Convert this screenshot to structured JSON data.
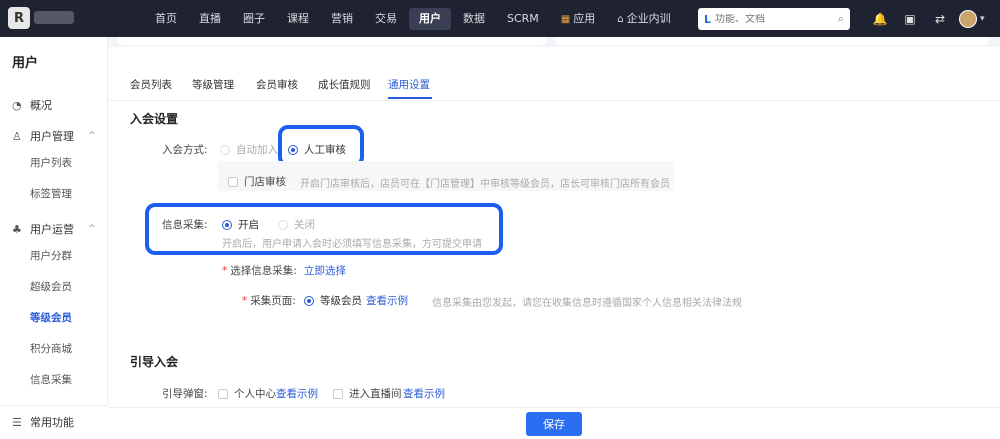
{
  "topbar": {
    "logo_char": "R",
    "nav": [
      {
        "label": "首页",
        "icon": ""
      },
      {
        "label": "直播",
        "icon": ""
      },
      {
        "label": "圈子",
        "icon": ""
      },
      {
        "label": "课程",
        "icon": ""
      },
      {
        "label": "营销",
        "icon": ""
      },
      {
        "label": "交易",
        "icon": ""
      },
      {
        "label": "用户",
        "icon": "",
        "active": true
      },
      {
        "label": "数据",
        "icon": ""
      },
      {
        "label": "SCRM",
        "icon": ""
      },
      {
        "label": "应用",
        "icon": "▦"
      },
      {
        "label": "企业内训",
        "icon": "⌂"
      }
    ],
    "search": {
      "placeholder": "功能、文档",
      "logo_glyph": "L"
    },
    "tools": [
      "🔔",
      "▣",
      "⇄"
    ]
  },
  "sidebar": {
    "title": "用户",
    "groups": [
      {
        "label": "概况",
        "icon": "◔"
      },
      {
        "label": "用户管理",
        "icon": "♙",
        "expand": "^"
      },
      {
        "label": "用户运营",
        "icon": "♣",
        "expand": "^"
      },
      {
        "label": "常用功能",
        "icon": "☰"
      }
    ],
    "sub_mgmt": [
      "用户列表",
      "标签管理"
    ],
    "sub_ops": [
      "用户分群",
      "超级会员",
      "等级会员",
      "积分商城",
      "信息采集"
    ]
  },
  "tabs": [
    "会员列表",
    "等级管理",
    "会员审核",
    "成长值规则",
    "通用设置"
  ],
  "join_settings": {
    "title": "入会设置",
    "mode_label": "入会方式:",
    "options": [
      "自动加入",
      "人工审核"
    ],
    "store_review_label": "门店审核",
    "store_review_hint": "开启门店审核后，店员可在【门店管理】中审核等级会员，店长可审核门店所有会员",
    "info_label": "信息采集:",
    "info_options": [
      "开启",
      "关闭"
    ],
    "info_hint": "开启后，用户申请入会时必须填写信息采集，方可提交申请",
    "select_label": "选择信息采集:",
    "select_link": "立即选择",
    "page_label": "采集页面:",
    "page_option": "等级会员",
    "page_link": "查看示例",
    "page_hint": "信息采集由您发起，请您在收集信息时遵循国家个人信息相关法律法规"
  },
  "guide": {
    "title": "引导入会",
    "popup_label": "引导弹窗:",
    "options": [
      {
        "label": "个人中心",
        "link": "查看示例"
      },
      {
        "label": "进入直播间",
        "link": "查看示例"
      }
    ]
  },
  "footer": {
    "save_label": "保存"
  },
  "colors": {
    "accent": "#2b5cd8",
    "highlight": "#1c5ff0",
    "topbar": "#1f2230"
  }
}
